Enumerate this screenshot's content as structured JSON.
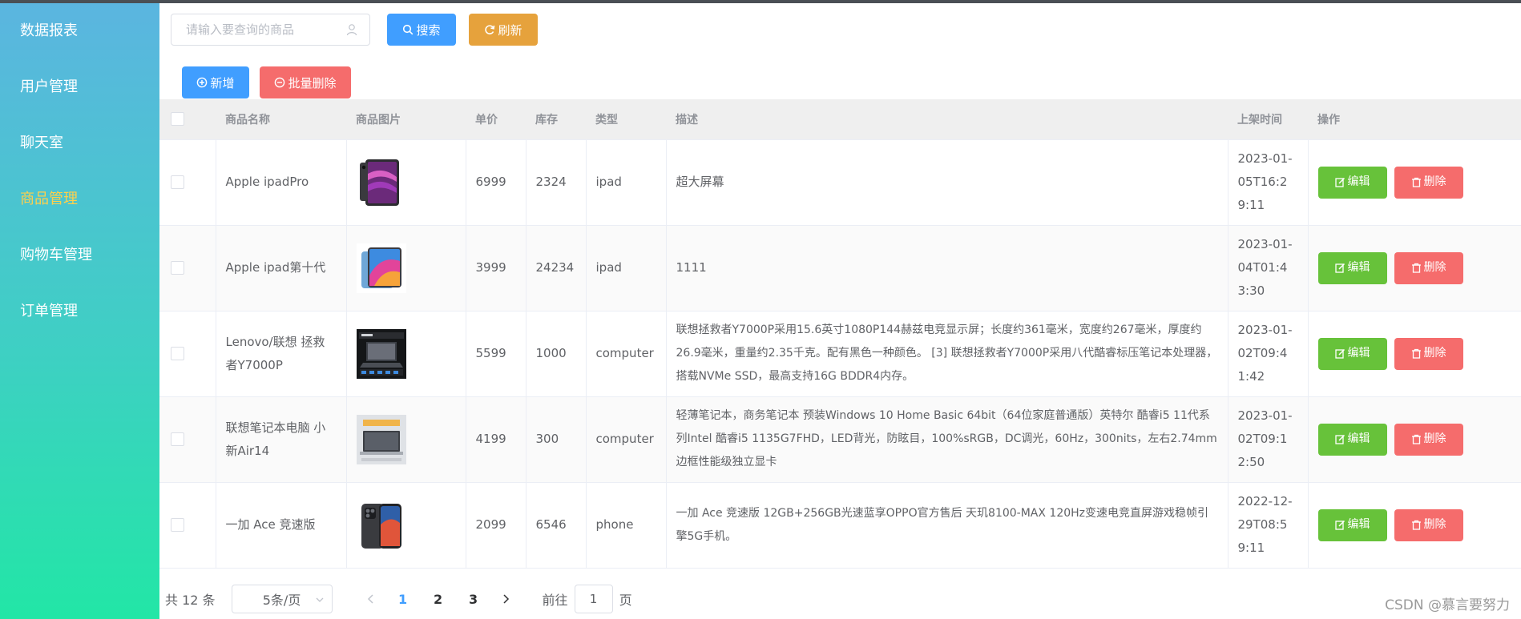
{
  "sidebar": {
    "items": [
      {
        "label": "数据报表"
      },
      {
        "label": "用户管理"
      },
      {
        "label": "聊天室"
      },
      {
        "label": "商品管理",
        "active": true
      },
      {
        "label": "购物车管理"
      },
      {
        "label": "订单管理"
      }
    ],
    "active_color": "#ffd04b"
  },
  "toolbar": {
    "search_placeholder": "请输入要查询的商品",
    "search_label": "搜索",
    "refresh_label": "刷新",
    "add_label": "新增",
    "batch_delete_label": "批量删除"
  },
  "table": {
    "headers": [
      "商品名称",
      "商品图片",
      "单价",
      "库存",
      "类型",
      "描述",
      "上架时间",
      "操作"
    ],
    "edit_label": "编辑",
    "delete_label": "删除",
    "rows": [
      {
        "name": "Apple ipadPro",
        "image": "ipad-pro-image",
        "price": "6999",
        "stock": "2324",
        "type": "ipad",
        "desc": "超大屏幕",
        "time": "2023-01-05T16:29:11"
      },
      {
        "name": "Apple ipad第十代",
        "image": "ipad-10-image",
        "price": "3999",
        "stock": "24234",
        "type": "ipad",
        "desc": "1111",
        "time": "2023-01-04T01:43:30"
      },
      {
        "name": "Lenovo/联想 拯救者Y7000P",
        "image": "lenovo-laptop-image",
        "price": "5599",
        "stock": "1000",
        "type": "computer",
        "desc": "联想拯救者Y7000P采用15.6英寸1080P144赫兹电竞显示屏；长度约361毫米，宽度约267毫米，厚度约26.9毫米，重量约2.35千克。配有黑色一种颜色。 [3] 联想拯救者Y7000P采用八代酷睿标压笔记本处理器，搭载NVMe SSD，最高支持16G BDDR4内存。",
        "time": "2023-01-02T09:41:42"
      },
      {
        "name": "联想笔记本电脑 小新Air14",
        "image": "xiaoxin-laptop-image",
        "price": "4199",
        "stock": "300",
        "type": "computer",
        "desc": "轻薄笔记本，商务笔记本 预装Windows 10 Home Basic 64bit（64位家庭普通版）英特尔 酷睿i5 11代系列Intel 酷睿i5 1135G7FHD，LED背光，防眩目，100%sRGB，DC调光，60Hz，300nits，左右2.74mm边框性能级独立显卡",
        "time": "2023-01-02T09:12:50"
      },
      {
        "name": "一加 Ace 竞速版",
        "image": "oneplus-phone-image",
        "price": "2099",
        "stock": "6546",
        "type": "phone",
        "desc": "一加 Ace 竞速版 12GB+256GB光速蓝享OPPO官方售后 天玑8100-MAX 120Hz变速电竞直屏游戏稳帧引擎5G手机。",
        "time": "2022-12-29T08:59:11"
      }
    ]
  },
  "pagination": {
    "total": "共 12 条",
    "page_size": "5条/页",
    "pages": [
      "1",
      "2",
      "3"
    ],
    "current": "1",
    "goto_prefix": "前往",
    "goto_value": "1",
    "goto_suffix": "页"
  },
  "watermark": "CSDN @慕言要努力"
}
